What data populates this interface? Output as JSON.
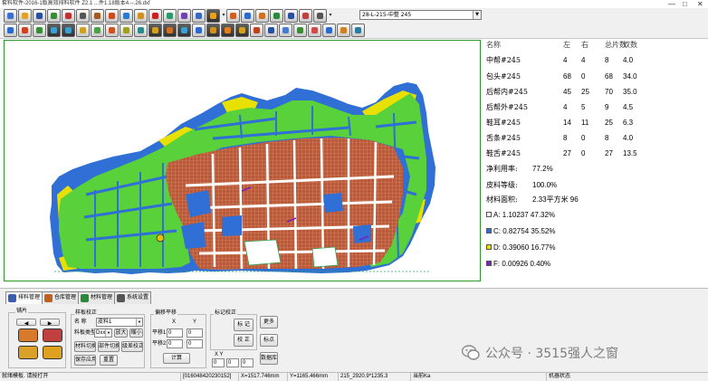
{
  "window": {
    "title": "套料软件-2016-1版高效排料软件 Z2.1 ...件1.18版本4.--.26.dxf",
    "controls": [
      "—",
      "□",
      "✕"
    ]
  },
  "toolbar": {
    "combo_value": "28-L-215-中整 245"
  },
  "stats": {
    "headers": {
      "name": "名称",
      "left": "左",
      "right": "右",
      "total": "总片数",
      "pairs": "双数"
    },
    "rows": [
      {
        "name": "中帮#245",
        "left": "4",
        "right": "4",
        "total": "8",
        "pairs": "4.0"
      },
      {
        "name": "包头#245",
        "left": "68",
        "right": "0",
        "total": "68",
        "pairs": "34.0"
      },
      {
        "name": "后帮内#245",
        "left": "45",
        "right": "25",
        "total": "70",
        "pairs": "35.0"
      },
      {
        "name": "后帮外#245",
        "left": "4",
        "right": "5",
        "total": "9",
        "pairs": "4.5"
      },
      {
        "name": "鞋耳#245",
        "left": "14",
        "right": "11",
        "total": "25",
        "pairs": "6.3"
      },
      {
        "name": "舌条#245",
        "left": "8",
        "right": "0",
        "total": "8",
        "pairs": "4.0"
      },
      {
        "name": "鞋舌#245",
        "left": "27",
        "right": "0",
        "total": "27",
        "pairs": "13.5"
      }
    ],
    "net_usage_label": "净利用率:",
    "net_usage_value": "77.2%",
    "leather_grade_label": "皮料等级:",
    "leather_grade_value": "100.0%",
    "material_area_label": "材料面积:",
    "material_area_value": "2.33平方米 96",
    "grades": [
      {
        "label": "A: 1.10237 47.32%",
        "color": "#ffffff"
      },
      {
        "label": "C: 0.82754 35.52%",
        "color": "#2f6fd6"
      },
      {
        "label": "D: 0.39060 16.77%",
        "color": "#e8e000"
      },
      {
        "label": "F: 0.00926 0.40%",
        "color": "#7a22b8"
      }
    ]
  },
  "bottom": {
    "tabs": [
      "排料管理",
      "仓库管理",
      "材料管理",
      "系统设置"
    ],
    "group_labels": {
      "pieces": "铺片",
      "sample": "样板校正",
      "offset": "偏移平移",
      "mark": "标记校正",
      "xy": "X    Y"
    },
    "sample_name_label": "名  称",
    "sample_name_value": "皮料1",
    "sample_type_label": "料板类型",
    "sample_type_value": "Dxx",
    "btn_zoom": "放大",
    "btn_shrink": "缩小",
    "btn_material_switch": "材料切换",
    "btn_part_switch": "部件切换",
    "btn_grade_adjust": "级差校正",
    "btn_save_apply": "保存应用",
    "btn_reset": "重置",
    "offset_x_label": "X",
    "offset_y_label": "Y",
    "move1_label": "平移1:",
    "move2_label": "平移2:",
    "move1_x": "0",
    "move1_y": "0",
    "move2_x": "0",
    "move2_y": "0",
    "btn_calc": "计算",
    "btn_mark1": "标  记",
    "btn_mark2": "校  正",
    "btn_more": "更多",
    "btn_mark_add": "标点",
    "btn_extra": "数据库",
    "xy_x": "0",
    "xy_y": "0",
    "xy_z": "0"
  },
  "status": {
    "cells": [
      "就绪模板. 请按打开",
      "[016048420230152]",
      "X=1517.746mm",
      "Y=1165.466mm",
      "215_2920.9*1235.3",
      "当前Ka",
      "机器状态"
    ]
  },
  "watermark": {
    "text": "公众号 · 3515强人之窗"
  }
}
